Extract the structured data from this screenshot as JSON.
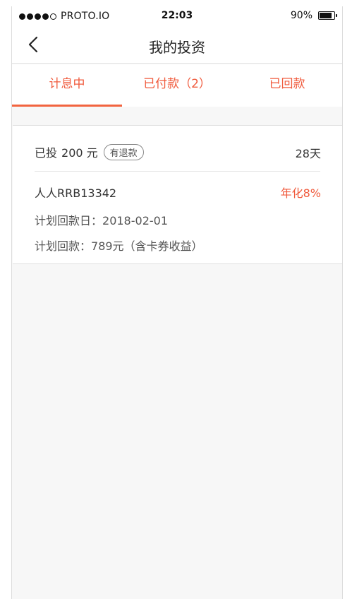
{
  "status_bar": {
    "carrier": "PROTO.IO",
    "time": "22:03",
    "battery_percent": "90%",
    "battery_level": 0.9
  },
  "nav": {
    "title": "我的投资",
    "back_icon": "chevron-left-icon"
  },
  "tabs": [
    {
      "label": "计息中",
      "active": true
    },
    {
      "label": "已付款（2）",
      "active": false
    },
    {
      "label": "已回款",
      "active": false
    }
  ],
  "investment": {
    "invested_prefix": "已投",
    "amount": "200 元",
    "badge": "有退款",
    "term": "28天",
    "product": "人人RRB13342",
    "annual_rate": "年化8%",
    "plan_date_label": "计划回款日：",
    "plan_date": "2018-02-01",
    "plan_amount_label": "计划回款：",
    "plan_amount": "789元（含卡券收益）"
  },
  "colors": {
    "accent": "#f05a3c",
    "tab_indicator": "#f2643f",
    "background": "#f7f7f7"
  }
}
